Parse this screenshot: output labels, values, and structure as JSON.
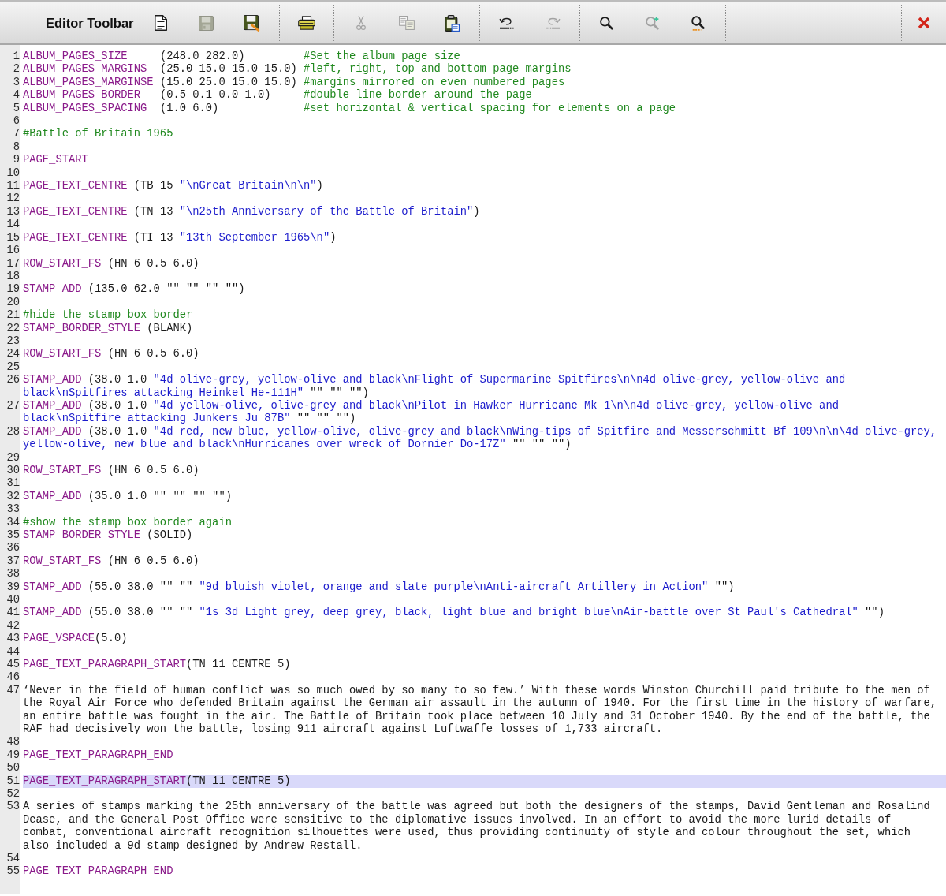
{
  "toolbar": {
    "title": "Editor Toolbar",
    "groups": [
      {
        "buttons": [
          {
            "kind": "new",
            "disabled": false
          },
          {
            "kind": "save",
            "disabled": true
          },
          {
            "kind": "save-as",
            "disabled": false
          }
        ]
      },
      {
        "buttons": [
          {
            "kind": "print",
            "disabled": false
          }
        ]
      },
      {
        "buttons": [
          {
            "kind": "cut",
            "disabled": true
          },
          {
            "kind": "copy",
            "disabled": true
          },
          {
            "kind": "paste",
            "disabled": false
          }
        ]
      },
      {
        "buttons": [
          {
            "kind": "undo",
            "disabled": false
          },
          {
            "kind": "redo",
            "disabled": true
          }
        ]
      },
      {
        "buttons": [
          {
            "kind": "find",
            "disabled": false
          },
          {
            "kind": "find-add",
            "disabled": true
          },
          {
            "kind": "find-all",
            "disabled": false
          }
        ]
      },
      {
        "buttons": [
          {
            "kind": "close",
            "disabled": false
          }
        ]
      }
    ]
  },
  "editor": {
    "lines": [
      {
        "number": "1",
        "current": false,
        "tokens": [
          {
            "kind": "keyword",
            "text": "ALBUM_PAGES_SIZE"
          },
          {
            "kind": "plain",
            "text": "     (248.0 282.0)"
          },
          {
            "kind": "comment",
            "text": "         #Set the album page size"
          }
        ]
      },
      {
        "number": "2",
        "current": false,
        "tokens": [
          {
            "kind": "keyword",
            "text": "ALBUM_PAGES_MARGINS"
          },
          {
            "kind": "plain",
            "text": "  (25.0 15.0 15.0 15.0)"
          },
          {
            "kind": "comment",
            "text": " #left, right, top and bottom page margins"
          }
        ]
      },
      {
        "number": "3",
        "current": false,
        "tokens": [
          {
            "kind": "keyword",
            "text": "ALBUM_PAGES_MARGINSE"
          },
          {
            "kind": "plain",
            "text": " (15.0 25.0 15.0 15.0)"
          },
          {
            "kind": "comment",
            "text": " #margins mirrored on even numbered pages"
          }
        ]
      },
      {
        "number": "4",
        "current": false,
        "tokens": [
          {
            "kind": "keyword",
            "text": "ALBUM_PAGES_BORDER"
          },
          {
            "kind": "plain",
            "text": "   (0.5 0.1 0.0 1.0)"
          },
          {
            "kind": "comment",
            "text": "     #double line border around the page"
          }
        ]
      },
      {
        "number": "5",
        "current": false,
        "tokens": [
          {
            "kind": "keyword",
            "text": "ALBUM_PAGES_SPACING"
          },
          {
            "kind": "plain",
            "text": "  (1.0 6.0)"
          },
          {
            "kind": "comment",
            "text": "             #set horizontal & vertical spacing for elements on a page"
          }
        ]
      },
      {
        "number": "6",
        "current": false
      },
      {
        "number": "7",
        "current": false,
        "tokens": [
          {
            "kind": "comment",
            "text": "#Battle of Britain 1965"
          }
        ]
      },
      {
        "number": "8",
        "current": false
      },
      {
        "number": "9",
        "current": false,
        "tokens": [
          {
            "kind": "keyword",
            "text": "PAGE_START"
          }
        ]
      },
      {
        "number": "10",
        "current": false
      },
      {
        "number": "11",
        "current": false,
        "tokens": [
          {
            "kind": "keyword",
            "text": "PAGE_TEXT_CENTRE"
          },
          {
            "kind": "plain",
            "text": " (TB 15"
          },
          {
            "kind": "string",
            "text": " \"\\nGreat Britain\\n\\n\""
          },
          {
            "kind": "plain",
            "text": ")"
          }
        ]
      },
      {
        "number": "12",
        "current": false
      },
      {
        "number": "13",
        "current": false,
        "tokens": [
          {
            "kind": "keyword",
            "text": "PAGE_TEXT_CENTRE"
          },
          {
            "kind": "plain",
            "text": " (TN 13"
          },
          {
            "kind": "string",
            "text": " \"\\n25th Anniversary of the Battle of Britain\""
          },
          {
            "kind": "plain",
            "text": ")"
          }
        ]
      },
      {
        "number": "14",
        "current": false
      },
      {
        "number": "15",
        "current": false,
        "tokens": [
          {
            "kind": "keyword",
            "text": "PAGE_TEXT_CENTRE"
          },
          {
            "kind": "plain",
            "text": " (TI 13"
          },
          {
            "kind": "string",
            "text": " \"13th September 1965\\n\""
          },
          {
            "kind": "plain",
            "text": ")"
          }
        ]
      },
      {
        "number": "16",
        "current": false
      },
      {
        "number": "17",
        "current": false,
        "tokens": [
          {
            "kind": "keyword",
            "text": "ROW_START_FS"
          },
          {
            "kind": "plain",
            "text": " (HN 6 0.5 6.0)"
          }
        ]
      },
      {
        "number": "18",
        "current": false
      },
      {
        "number": "19",
        "current": false,
        "tokens": [
          {
            "kind": "keyword",
            "text": "STAMP_ADD"
          },
          {
            "kind": "plain",
            "text": " (135.0 62.0 \"\" \"\" \"\" \"\")"
          }
        ]
      },
      {
        "number": "20",
        "current": false
      },
      {
        "number": "21",
        "current": false,
        "tokens": [
          {
            "kind": "comment",
            "text": "#hide the stamp box border"
          }
        ]
      },
      {
        "number": "22",
        "current": false,
        "tokens": [
          {
            "kind": "keyword",
            "text": "STAMP_BORDER_STYLE"
          },
          {
            "kind": "plain",
            "text": " (BLANK)"
          }
        ]
      },
      {
        "number": "23",
        "current": false
      },
      {
        "number": "24",
        "current": false,
        "tokens": [
          {
            "kind": "keyword",
            "text": "ROW_START_FS"
          },
          {
            "kind": "plain",
            "text": " (HN 6 0.5 6.0)"
          }
        ]
      },
      {
        "number": "25",
        "current": false
      },
      {
        "number": "26",
        "current": false,
        "tokens": [
          {
            "kind": "keyword",
            "text": "STAMP_ADD"
          },
          {
            "kind": "plain",
            "text": " (38.0 1.0"
          },
          {
            "kind": "string",
            "text": " \"4d olive-grey, yellow-olive and black\\nFlight of Supermarine Spitfires\\n\\n4d olive-grey, yellow-olive and"
          }
        ],
        "continued_rows": [
          {
            "tokens": [
              {
                "kind": "string",
                "text": "black\\nSpitfires attacking Heinkel He-111H\""
              },
              {
                "kind": "plain",
                "text": " \"\" \"\" \"\")"
              }
            ]
          }
        ]
      },
      {
        "number": "27",
        "current": false,
        "tokens": [
          {
            "kind": "keyword",
            "text": "STAMP_ADD"
          },
          {
            "kind": "plain",
            "text": " (38.0 1.0"
          },
          {
            "kind": "string",
            "text": " \"4d yellow-olive, olive-grey and black\\nPilot in Hawker Hurricane Mk 1\\n\\n4d olive-grey, yellow-olive and"
          }
        ],
        "continued_rows": [
          {
            "tokens": [
              {
                "kind": "string",
                "text": "black\\nSpitfire attacking Junkers Ju 87B\""
              },
              {
                "kind": "plain",
                "text": " \"\" \"\" \"\")"
              }
            ]
          }
        ]
      },
      {
        "number": "28",
        "current": false,
        "tokens": [
          {
            "kind": "keyword",
            "text": "STAMP_ADD"
          },
          {
            "kind": "plain",
            "text": " (38.0 1.0"
          },
          {
            "kind": "string",
            "text": " \"4d red, new blue, yellow-olive, olive-grey and black\\nWing-tips of Spitfire and Messerschmitt Bf 109\\n\\n\\4d olive-grey,"
          }
        ],
        "continued_rows": [
          {
            "tokens": [
              {
                "kind": "string",
                "text": "yellow-olive, new blue and black\\nHurricanes over wreck of Dornier Do-17Z\""
              },
              {
                "kind": "plain",
                "text": " \"\" \"\" \"\")"
              }
            ]
          }
        ]
      },
      {
        "number": "29",
        "current": false
      },
      {
        "number": "30",
        "current": false,
        "tokens": [
          {
            "kind": "keyword",
            "text": "ROW_START_FS"
          },
          {
            "kind": "plain",
            "text": " (HN 6 0.5 6.0)"
          }
        ]
      },
      {
        "number": "31",
        "current": false
      },
      {
        "number": "32",
        "current": false,
        "tokens": [
          {
            "kind": "keyword",
            "text": "STAMP_ADD"
          },
          {
            "kind": "plain",
            "text": " (35.0 1.0 \"\" \"\" \"\" \"\")"
          }
        ]
      },
      {
        "number": "33",
        "current": false
      },
      {
        "number": "34",
        "current": false,
        "tokens": [
          {
            "kind": "comment",
            "text": "#show the stamp box border again"
          }
        ]
      },
      {
        "number": "35",
        "current": false,
        "tokens": [
          {
            "kind": "keyword",
            "text": "STAMP_BORDER_STYLE"
          },
          {
            "kind": "plain",
            "text": " (SOLID)"
          }
        ]
      },
      {
        "number": "36",
        "current": false
      },
      {
        "number": "37",
        "current": false,
        "tokens": [
          {
            "kind": "keyword",
            "text": "ROW_START_FS"
          },
          {
            "kind": "plain",
            "text": " (HN 6 0.5 6.0)"
          }
        ]
      },
      {
        "number": "38",
        "current": false
      },
      {
        "number": "39",
        "current": false,
        "tokens": [
          {
            "kind": "keyword",
            "text": "STAMP_ADD"
          },
          {
            "kind": "plain",
            "text": " (55.0 38.0 \"\" \"\""
          },
          {
            "kind": "string",
            "text": " \"9d bluish violet, orange and slate purple\\nAnti-aircraft Artillery in Action\""
          },
          {
            "kind": "plain",
            "text": " \"\")"
          }
        ]
      },
      {
        "number": "40",
        "current": false
      },
      {
        "number": "41",
        "current": false,
        "tokens": [
          {
            "kind": "keyword",
            "text": "STAMP_ADD"
          },
          {
            "kind": "plain",
            "text": " (55.0 38.0 \"\" \"\""
          },
          {
            "kind": "string",
            "text": " \"1s 3d Light grey, deep grey, black, light blue and bright blue\\nAir-battle over St Paul's Cathedral\""
          },
          {
            "kind": "plain",
            "text": " \"\")"
          }
        ]
      },
      {
        "number": "42",
        "current": false
      },
      {
        "number": "43",
        "current": false,
        "tokens": [
          {
            "kind": "keyword",
            "text": "PAGE_VSPACE"
          },
          {
            "kind": "plain",
            "text": "(5.0)"
          }
        ]
      },
      {
        "number": "44",
        "current": false
      },
      {
        "number": "45",
        "current": false,
        "tokens": [
          {
            "kind": "keyword",
            "text": "PAGE_TEXT_PARAGRAPH_START"
          },
          {
            "kind": "plain",
            "text": "(TN 11 CENTRE 5)"
          }
        ]
      },
      {
        "number": "46",
        "current": false
      },
      {
        "number": "47",
        "current": false,
        "tokens": [
          {
            "kind": "text",
            "text": "‘Never in the field of human conflict was so much owed by so many to so few.’ With these words Winston Churchill paid tribute to the men of"
          }
        ],
        "continued_rows": [
          {
            "tokens": [
              {
                "kind": "text",
                "text": "the Royal Air Force who defended Britain against the German air assault in the autumn of 1940. For the first time in the history of warfare,"
              }
            ]
          },
          {
            "tokens": [
              {
                "kind": "text",
                "text": "an entire battle was fought in the air. The Battle of Britain took place between 10 July and 31 October 1940. By the end of the battle, the"
              }
            ]
          },
          {
            "tokens": [
              {
                "kind": "text",
                "text": "RAF had decisively won the battle, losing 911 aircraft against Luftwaffe losses of 1,733 aircraft."
              }
            ]
          }
        ]
      },
      {
        "number": "48",
        "current": false
      },
      {
        "number": "49",
        "current": false,
        "tokens": [
          {
            "kind": "keyword",
            "text": "PAGE_TEXT_PARAGRAPH_END"
          }
        ]
      },
      {
        "number": "50",
        "current": false
      },
      {
        "number": "51",
        "current": true,
        "tokens": [
          {
            "kind": "keyword",
            "text": "PAGE_TEXT_PARAGRAPH_START"
          },
          {
            "kind": "plain",
            "text": "(TN 11 CENTRE 5)"
          }
        ]
      },
      {
        "number": "52",
        "current": false
      },
      {
        "number": "53",
        "current": false,
        "tokens": [
          {
            "kind": "text",
            "text": "A series of stamps marking the 25th anniversary of the battle was agreed but both the designers of the stamps, David Gentleman and Rosalind"
          }
        ],
        "continued_rows": [
          {
            "tokens": [
              {
                "kind": "text",
                "text": "Dease, and the General Post Office were sensitive to the diplomative issues involved. In an effort to avoid the more lurid details of"
              }
            ]
          },
          {
            "tokens": [
              {
                "kind": "text",
                "text": "combat, conventional aircraft recognition silhouettes were used, thus providing continuity of style and colour throughout the set, which"
              }
            ]
          },
          {
            "tokens": [
              {
                "kind": "text",
                "text": "also included a 9d stamp designed by Andrew Restall."
              }
            ]
          }
        ]
      },
      {
        "number": "54",
        "current": false
      },
      {
        "number": "55",
        "current": false,
        "tokens": [
          {
            "kind": "keyword",
            "text": "PAGE_TEXT_PARAGRAPH_END"
          }
        ]
      }
    ]
  }
}
